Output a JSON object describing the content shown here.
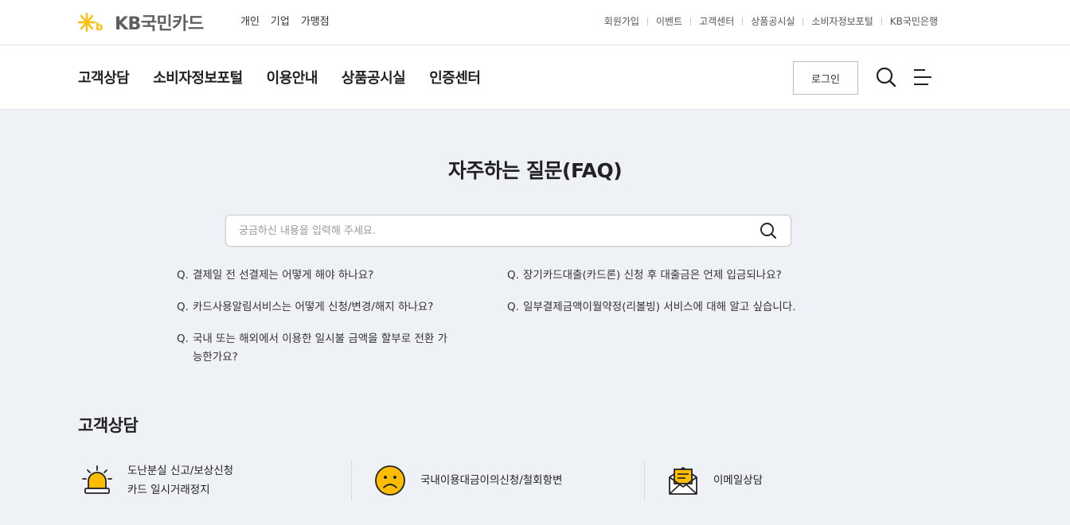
{
  "brand": {
    "name": "KB국민카드",
    "accent": "#ffbc00"
  },
  "segments": [
    "개인",
    "기업",
    "가맹점"
  ],
  "util_links": [
    "회원가입",
    "이벤트",
    "고객센터",
    "상품공시실",
    "소비자정보포털",
    "KB국민은행"
  ],
  "gnb": {
    "menu": [
      "고객상담",
      "소비자정보포털",
      "이용안내",
      "상품공시실",
      "인증센터"
    ],
    "login_label": "로그인",
    "search_icon": "search-icon",
    "menu_icon": "hamburger-menu-icon"
  },
  "faq": {
    "title": "자주하는 질문(FAQ)",
    "search_placeholder": "궁금하신 내용을 입력해 주세요.",
    "prefix": "Q.",
    "left": [
      "결제일 전 선결제는 어떻게 해야 하나요?",
      "카드사용알림서비스는 어떻게 신청/변경/해지 하나요?",
      "국내 또는 해외에서 이용한 일시불 금액을 할부로 전환 가능한가요?"
    ],
    "right": [
      "장기카드대출(카드론) 신청 후 대출금은 언제 입금되나요?",
      "일부결제금액이월약정(리볼빙) 서비스에 대해 알고 싶습니다."
    ]
  },
  "consult": {
    "title": "고객상담",
    "items": [
      {
        "icon": "siren-icon",
        "lines": [
          "도난분실 신고/보상신청",
          "카드 일시거래정지"
        ]
      },
      {
        "icon": "sad-face-icon",
        "lines": [
          "국내이용대금이의신청/철회항변"
        ]
      },
      {
        "icon": "envelope-icon",
        "lines": [
          "이메일상담"
        ]
      }
    ]
  }
}
